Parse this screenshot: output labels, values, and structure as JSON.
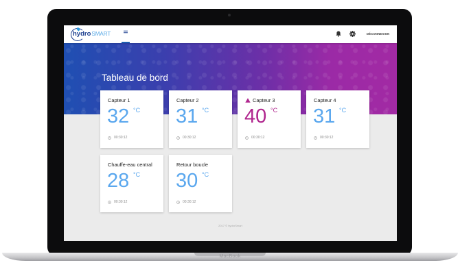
{
  "app": {
    "logo_main": "hydro",
    "logo_accent": "SMART",
    "nav_icon": "grid-icon",
    "actions": {
      "notifications_icon": "bell-icon",
      "settings_icon": "gear-icon",
      "logout_label": "DÉCONNEXION"
    }
  },
  "dashboard": {
    "title": "Tableau de bord",
    "sensors": [
      {
        "name": "Capteur 1",
        "temp": "32",
        "unit": "°C",
        "time": "00:30:12",
        "alert": false
      },
      {
        "name": "Capteur 2",
        "temp": "31",
        "unit": "°C",
        "time": "00:30:12",
        "alert": false
      },
      {
        "name": "Capteur 3",
        "temp": "40",
        "unit": "°C",
        "time": "00:30:12",
        "alert": true
      },
      {
        "name": "Capteur 4",
        "temp": "31",
        "unit": "°C",
        "time": "00:30:12",
        "alert": false
      },
      {
        "name": "Chauffe-eau central",
        "temp": "28",
        "unit": "°C",
        "time": "00:30:12",
        "alert": false
      },
      {
        "name": "Retour boucle",
        "temp": "30",
        "unit": "°C",
        "time": "00:30:12",
        "alert": false
      }
    ],
    "footer": "2017 © hydroSmart"
  },
  "device": {
    "brand": "MacBook"
  },
  "colors": {
    "accent_blue": "#5aa7ee",
    "alert_magenta": "#b0268e",
    "brand_navy": "#1c3f8f"
  }
}
